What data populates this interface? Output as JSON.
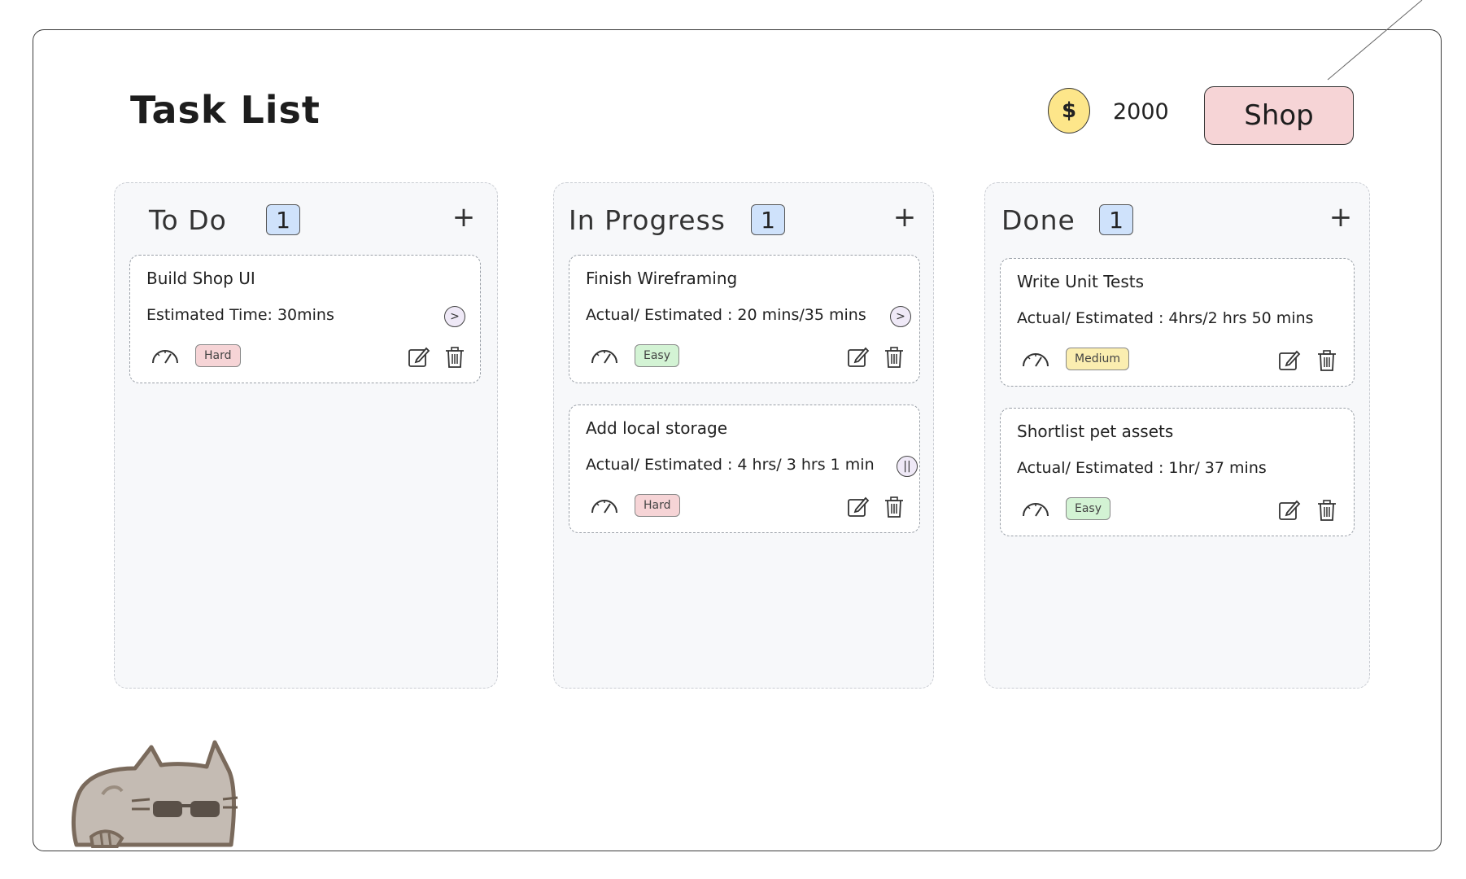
{
  "header": {
    "title": "Task List",
    "coin_symbol": "$",
    "coins": "2000",
    "shop_label": "Shop"
  },
  "columns": [
    {
      "title": "To Do",
      "count": "1",
      "add_label": "+",
      "cards": [
        {
          "title": "Build Shop UI",
          "time": "Estimated Time: 30mins",
          "difficulty": "Hard",
          "action": "next"
        }
      ]
    },
    {
      "title": "In Progress",
      "count": "1",
      "add_label": "+",
      "cards": [
        {
          "title": "Finish Wireframing",
          "time": "Actual/ Estimated : 20 mins/35 mins",
          "difficulty": "Easy",
          "action": "next"
        },
        {
          "title": "Add local storage",
          "time": "Actual/ Estimated : 4 hrs/ 3 hrs 1 min",
          "difficulty": "Hard",
          "action": "pause"
        }
      ]
    },
    {
      "title": "Done",
      "count": "1",
      "add_label": "+",
      "cards": [
        {
          "title": "Write Unit Tests",
          "time": "Actual/ Estimated : 4hrs/2 hrs 50 mins",
          "difficulty": "Medium"
        },
        {
          "title": "Shortlist pet assets",
          "time": "Actual/ Estimated : 1hr/ 37 mins",
          "difficulty": "Easy"
        }
      ]
    }
  ],
  "icons": {
    "coin": "dollar-coin-icon",
    "speed": "speedometer-icon",
    "edit": "edit-pencil-icon",
    "delete": "trash-icon",
    "next": "chevron-right-circle-icon",
    "pause": "pause-circle-icon",
    "pet": "pusheen-cat-mascot"
  },
  "colors": {
    "shop_button": "#f6d4d6",
    "coin": "#fde68a",
    "count_badge": "#cfe2fb",
    "hard_badge": "#f6d4d6",
    "easy_badge": "#d3f3d4",
    "medium_badge": "#fbeeb0",
    "column_bg": "#f7f8fa"
  }
}
